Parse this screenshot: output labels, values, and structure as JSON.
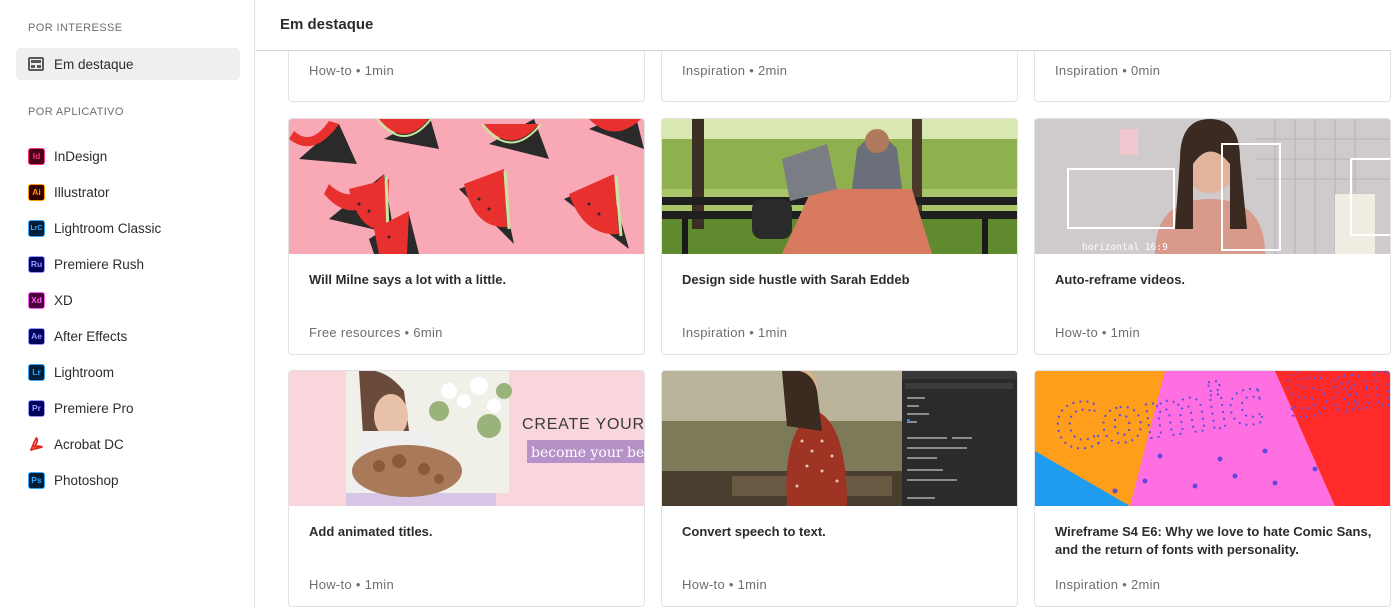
{
  "sidebar": {
    "by_interest_label": "POR INTERESSE",
    "featured_label": "Em destaque",
    "by_app_label": "POR APLICATIVO",
    "apps": [
      {
        "label": "InDesign",
        "abbr": "Id",
        "fg": "#ff3366",
        "bg": "#49021f"
      },
      {
        "label": "Illustrator",
        "abbr": "Ai",
        "fg": "#ff9a00",
        "bg": "#330000"
      },
      {
        "label": "Lightroom Classic",
        "abbr": "LrC",
        "fg": "#31a8ff",
        "bg": "#001e36"
      },
      {
        "label": "Premiere Rush",
        "abbr": "Ru",
        "fg": "#9999ff",
        "bg": "#00005b"
      },
      {
        "label": "XD",
        "abbr": "Xd",
        "fg": "#ff61f6",
        "bg": "#470137"
      },
      {
        "label": "After Effects",
        "abbr": "Ae",
        "fg": "#9999ff",
        "bg": "#00005b"
      },
      {
        "label": "Lightroom",
        "abbr": "Lr",
        "fg": "#31a8ff",
        "bg": "#001e36"
      },
      {
        "label": "Premiere Pro",
        "abbr": "Pr",
        "fg": "#9999ff",
        "bg": "#00005b"
      },
      {
        "label": "Acrobat DC",
        "abbr": "",
        "fg": "#e1251b",
        "bg": "#ffffff"
      },
      {
        "label": "Photoshop",
        "abbr": "Ps",
        "fg": "#31a8ff",
        "bg": "#001e36"
      }
    ]
  },
  "header": {
    "title": "Em destaque"
  },
  "top_row": [
    {
      "meta": "How-to • 1min"
    },
    {
      "meta": "Inspiration • 2min"
    },
    {
      "meta": "Inspiration • 0min"
    }
  ],
  "cards": [
    {
      "title": "Will Milne says a lot with a little.",
      "meta": "Free resources • 6min",
      "image": "watermelon-pattern"
    },
    {
      "title": "Design side hustle with Sarah Eddeb",
      "meta": "Inspiration • 1min",
      "image": "woman-laptop-bench"
    },
    {
      "title": "Auto-reframe videos.",
      "meta": "How-to • 1min",
      "image": "auto-reframe",
      "image_text": "horizontal 16:9"
    },
    {
      "title": "Add animated titles.",
      "meta": "How-to • 1min",
      "image": "animated-titles",
      "image_text_1": "CREATE YOUR DI",
      "image_text_2": "become your bes"
    },
    {
      "title": "Convert speech to text.",
      "meta": "How-to • 1min",
      "image": "speech-to-text"
    },
    {
      "title": "Wireframe S4 E6: Why we love to hate Comic Sans, and the return of fonts with personality.",
      "meta": "Inspiration • 2min",
      "image": "comic-sans",
      "image_text": "Comic Sans"
    }
  ]
}
